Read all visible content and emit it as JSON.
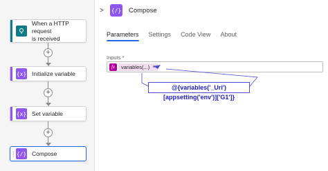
{
  "canvas": {
    "nodes": [
      {
        "label_line1": "When a HTTP request",
        "label_line2": "is received",
        "icon": "http-request-icon",
        "color": "#0e7c86"
      },
      {
        "label": "Initialize variable",
        "icon": "variable-icon",
        "glyph": "{x}",
        "color": "#8e57f0"
      },
      {
        "label": "Set variable",
        "icon": "variable-icon",
        "glyph": "{x}",
        "color": "#8e57f0"
      },
      {
        "label": "Compose",
        "icon": "compose-icon",
        "glyph": "{/}",
        "color": "#8e57f0"
      }
    ],
    "add_glyph": "+"
  },
  "panel": {
    "title": "Compose",
    "icon_glyph": "{/}",
    "collapse_glyph": ">",
    "tabs": [
      "Parameters",
      "Settings",
      "Code View",
      "About"
    ],
    "active_tab": "Parameters",
    "inputs_label": "Inputs *",
    "fx_glyph": "fx",
    "token_label": "variables(...)",
    "token_close": "×"
  },
  "callout": {
    "text": "@{variables('_Uri')[appsetting('env')]['G1']}"
  },
  "colors": {
    "accent": "#2266e3",
    "action_purple": "#8e57f0",
    "trigger_teal": "#0e7c86",
    "expression_magenta": "#b4009e",
    "callout_blue": "#1e1ec8"
  }
}
